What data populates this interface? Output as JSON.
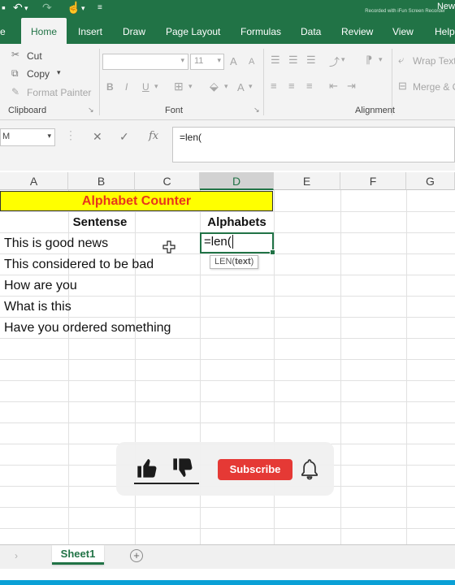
{
  "titlebar": {
    "title": "New",
    "watermark": "Recorded with iFun Screen Recorder",
    "qa_icons": [
      "excel-icon",
      "undo-icon",
      "redo-icon",
      "touch-mode-icon",
      "customize-icon"
    ]
  },
  "tabs": [
    "e",
    "Home",
    "Insert",
    "Draw",
    "Page Layout",
    "Formulas",
    "Data",
    "Review",
    "View",
    "Help"
  ],
  "clipboard": {
    "cut": "Cut",
    "copy": "Copy",
    "format_painter": "Format Painter",
    "label": "Clipboard"
  },
  "font": {
    "size": "11",
    "grow": "A",
    "shrink": "A",
    "bold": "B",
    "italic": "I",
    "underline": "U",
    "label": "Font"
  },
  "alignment": {
    "wrap_text": "Wrap Text",
    "merge": "Merge & C",
    "label": "Alignment"
  },
  "formula_bar": {
    "name_box": "M",
    "fx": "fx",
    "content": "=len("
  },
  "columns": [
    "A",
    "B",
    "C",
    "D",
    "E",
    "F",
    "G"
  ],
  "sheet": {
    "banner": "Alphabet Counter",
    "header_sentence": "Sentense",
    "header_alphabets": "Alphabets",
    "rows": [
      "This is good news",
      "This considered to be bad",
      "How are you",
      "What is this",
      "Have you ordered something"
    ],
    "active_cell_text": "=len(",
    "tooltip_func": "LEN(",
    "tooltip_arg": "text",
    "tooltip_close": ")"
  },
  "subscribe": {
    "label": "Subscribe",
    "accent": "#e53935"
  },
  "sheet_tabs": {
    "active": "Sheet1",
    "add": "+"
  },
  "colors": {
    "excel_green": "#217346",
    "banner_fill": "#ffff00",
    "banner_text": "#e8351b"
  }
}
